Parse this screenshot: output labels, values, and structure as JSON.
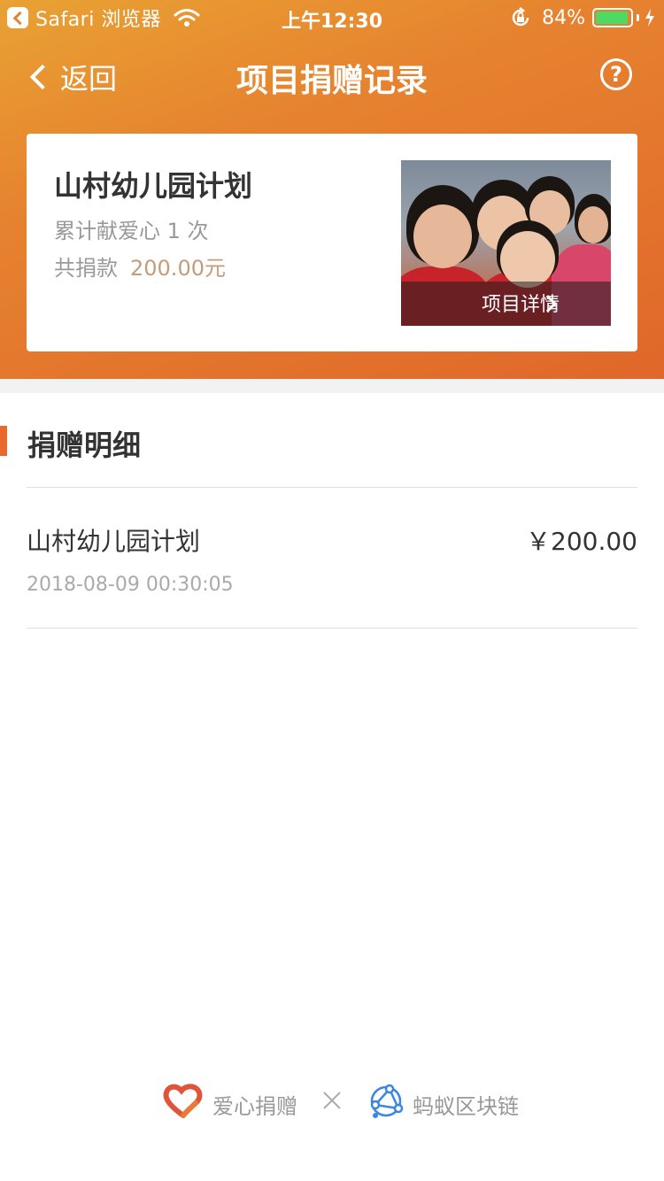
{
  "status_bar": {
    "app": "Safari 浏览器",
    "time": "上午12:30",
    "battery": "84%"
  },
  "nav": {
    "back_label": "返回",
    "title": "项目捐赠记录"
  },
  "summary": {
    "project_name": "山村幼儿园计划",
    "donation_count_text": "累计献爱心 1 次",
    "total_label": "共捐款",
    "total_amount": "200.00元",
    "detail_link": "项目详情"
  },
  "details": {
    "section_title": "捐赠明细",
    "records": [
      {
        "name": "山村幼儿园计划",
        "amount": "￥200.00",
        "time": "2018-08-09 00:30:05"
      }
    ]
  },
  "footer": {
    "left_label": "爱心捐赠",
    "right_label": "蚂蚁区块链"
  },
  "colors": {
    "accent": "#e8692c",
    "amount_gold": "#c59c7a",
    "battery_green": "#4cd964",
    "chain_blue": "#3b86e0"
  }
}
